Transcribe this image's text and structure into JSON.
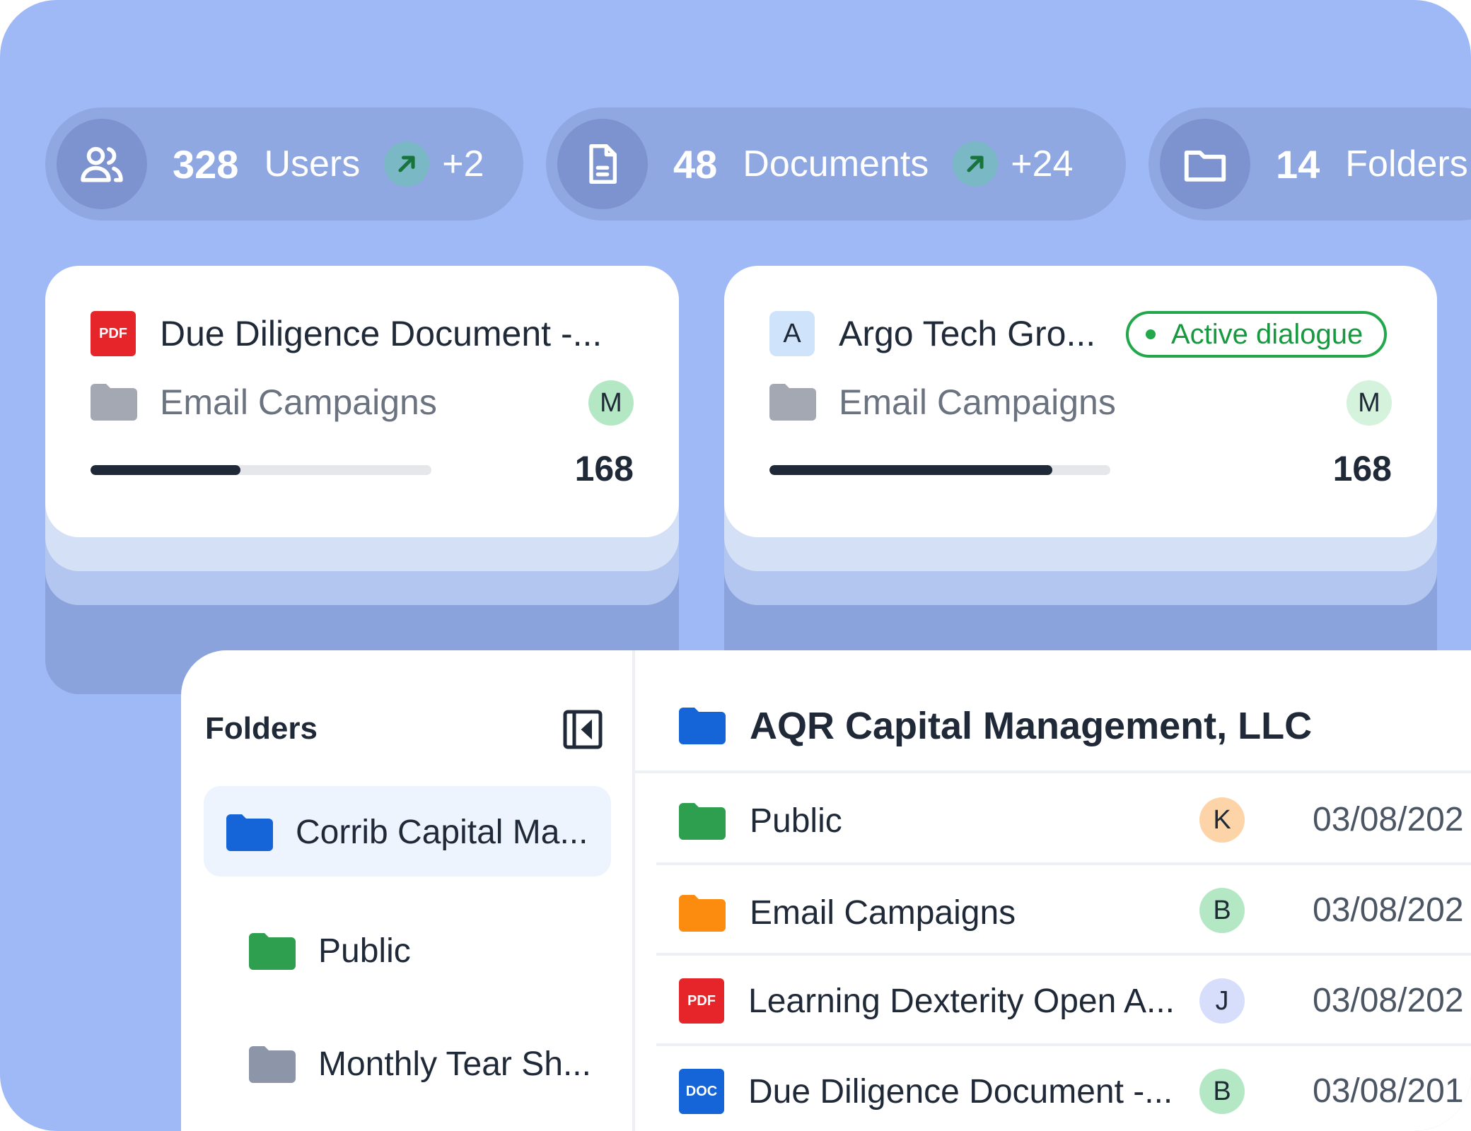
{
  "stats": [
    {
      "value": "328",
      "label": "Users",
      "delta": "+2",
      "icon": "users-icon"
    },
    {
      "value": "48",
      "label": "Documents",
      "delta": "+24",
      "icon": "document-icon"
    },
    {
      "value": "14",
      "label": "Folders",
      "icon": "folder-icon"
    }
  ],
  "cards": [
    {
      "file_badge": "PDF",
      "title": "Due Diligence Document -...",
      "folder": "Email Campaigns",
      "avatar": "M",
      "progress": 0.44,
      "count": "168"
    },
    {
      "file_badge": "A",
      "title": "Argo Tech Gro...",
      "status": "Active dialogue",
      "folder": "Email Campaigns",
      "avatar": "M",
      "progress": 0.83,
      "count": "168"
    }
  ],
  "sidebar": {
    "title": "Folders",
    "items": [
      {
        "label": "Corrib Capital Ma...",
        "color": "#1565d8",
        "selected": true
      },
      {
        "label": "Public",
        "color": "#2e9e4f"
      },
      {
        "label": "Monthly Tear Sh...",
        "color": "#8d96a8"
      }
    ]
  },
  "main": {
    "title": "AQR Capital Management, LLC",
    "rows": [
      {
        "name": "Public",
        "type": "folder",
        "color": "#2e9e4f",
        "avatar": "K",
        "avatar_color": "#fdd4a8",
        "date": "03/08/202"
      },
      {
        "name": "Email Campaigns",
        "type": "folder",
        "color": "#fb8c10",
        "avatar": "B",
        "avatar_color": "#b4e8c4",
        "date": "03/08/202"
      },
      {
        "name": "Learning Dexterity Open A...",
        "type": "pdf",
        "badge": "PDF",
        "avatar": "J",
        "avatar_color": "#d6defb",
        "date": "03/08/202"
      },
      {
        "name": "Due Diligence Document -...",
        "type": "doc",
        "badge": "DOC",
        "avatar": "B",
        "avatar_color": "#b4e8c4",
        "date": "03/08/201"
      }
    ]
  },
  "colors": {
    "background": "#9fb9f7",
    "accent_green": "#22a84a",
    "blue_folder": "#1565d8"
  }
}
